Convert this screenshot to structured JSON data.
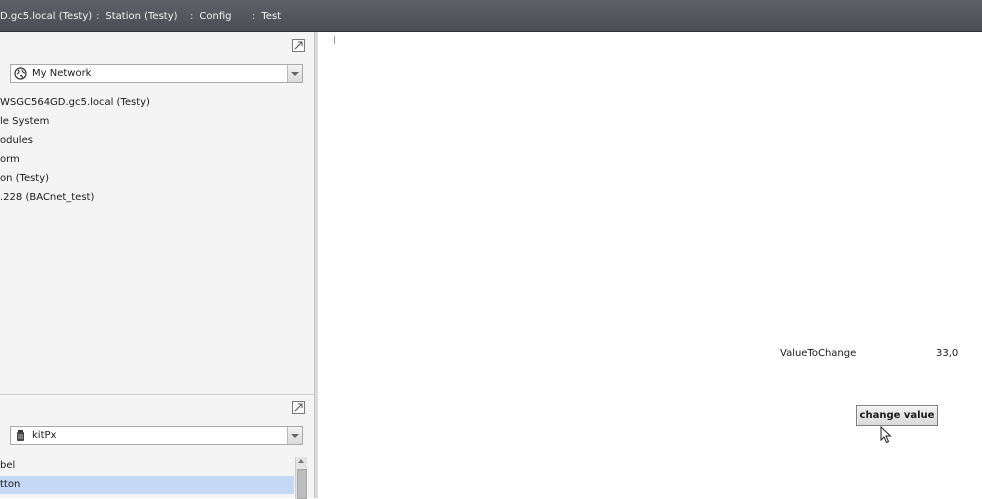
{
  "breadcrumb": [
    "D.gc5.local (Testy)",
    "Station (Testy)",
    "Config",
    "Test"
  ],
  "nav_pane": {
    "selector_value": "My Network",
    "selector_icon": "globe-icon",
    "tree_items": [
      "WSGC564GD.gc5.local (Testy)",
      "le System",
      "odules",
      "orm",
      "on (Testy)",
      ".228 (BACnet_test)"
    ]
  },
  "palette_pane": {
    "selector_value": "kitPx",
    "selector_icon": "palette-jar-icon",
    "list_items": [
      {
        "label": "bel",
        "selected": false
      },
      {
        "label": "tton",
        "selected": true
      }
    ]
  },
  "canvas": {
    "value_label": "ValueToChange",
    "value": "33,0",
    "button_label": "change value"
  },
  "colors": {
    "topbar": "#55595f",
    "selection": "#c5d8f5",
    "sidebar": "#f4f4f4"
  }
}
